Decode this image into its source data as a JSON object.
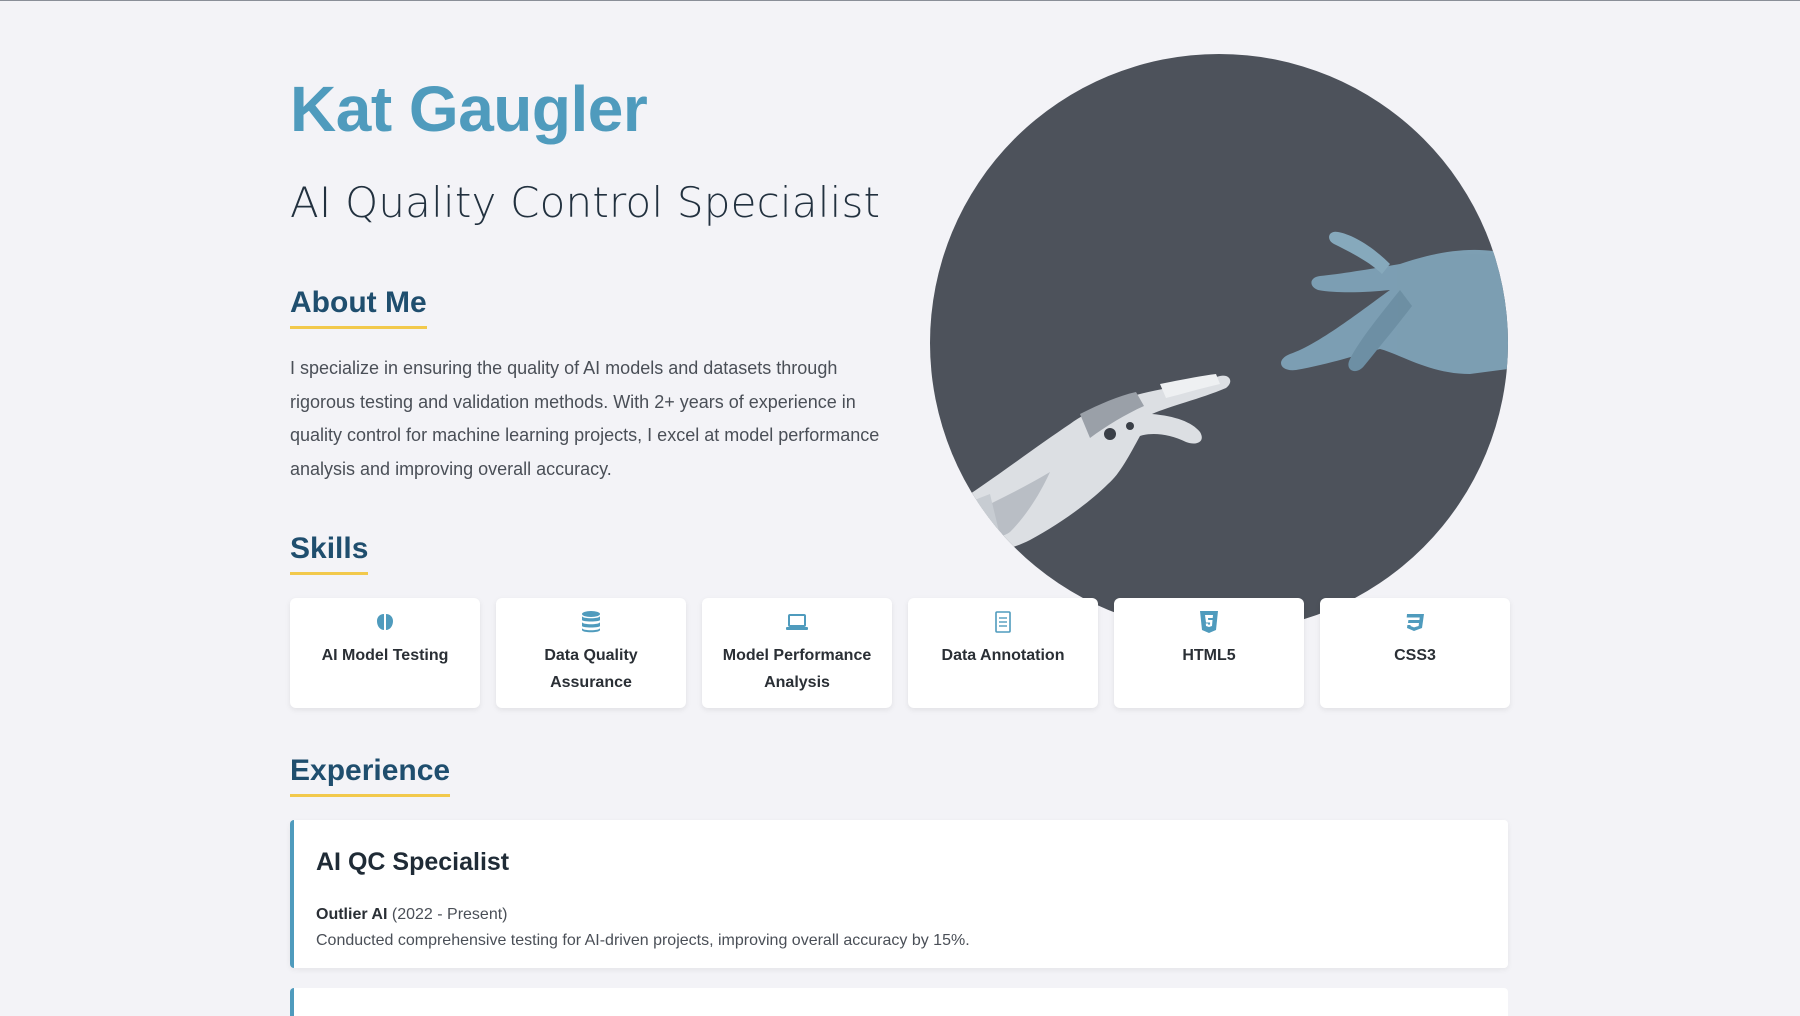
{
  "header": {
    "name": "Kat Gaugler",
    "role": "AI Quality Control Specialist"
  },
  "about": {
    "title": "About Me",
    "text": "I specialize in ensuring the quality of AI models and datasets through rigorous testing and validation methods. With 2+ years of experience in quality control for machine learning projects, I excel at model performance analysis and improving overall accuracy."
  },
  "hero": {
    "icon": "robot-human-hands-image"
  },
  "skills": {
    "title": "Skills",
    "items": [
      {
        "label": "AI Model Testing",
        "icon": "brain-icon"
      },
      {
        "label": "Data Quality Assurance",
        "icon": "database-icon"
      },
      {
        "label": "Model Performance Analysis",
        "icon": "laptop-icon"
      },
      {
        "label": "Data Annotation",
        "icon": "document-list-icon"
      },
      {
        "label": "HTML5",
        "icon": "html5-icon"
      },
      {
        "label": "CSS3",
        "icon": "css3-icon"
      }
    ]
  },
  "experience": {
    "title": "Experience",
    "items": [
      {
        "job_title": "AI QC Specialist",
        "company": "Outlier AI",
        "period": "(2022 - Present)",
        "description": "Conducted comprehensive testing for AI-driven projects, improving overall accuracy by 15%."
      }
    ]
  },
  "colors": {
    "accent": "#4f9bbd",
    "heading": "#1f4e6e",
    "underline": "#f2c94c",
    "background": "#f3f3f7"
  }
}
